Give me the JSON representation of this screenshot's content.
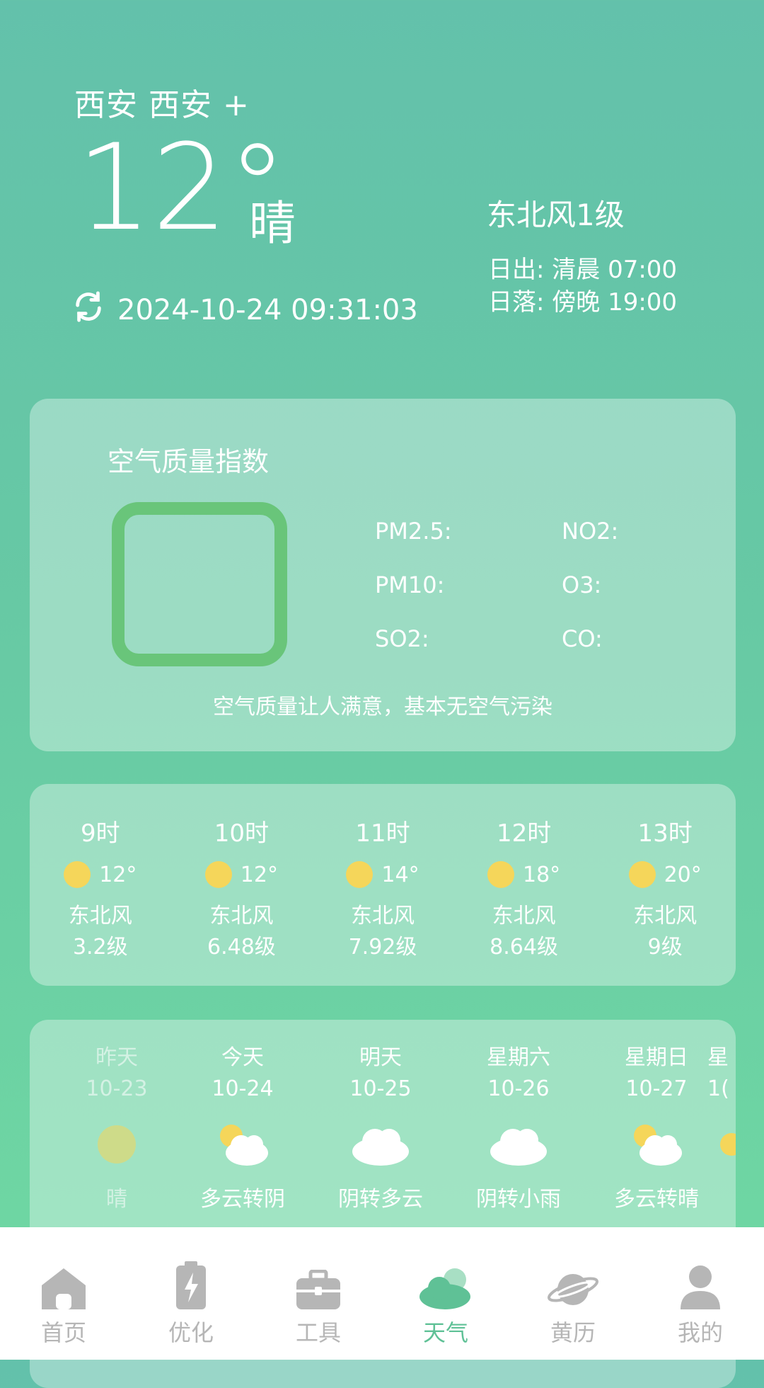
{
  "header": {
    "location": "西安 西安 +",
    "temperature": "12°",
    "condition": "晴",
    "wind": "东北风1级",
    "sunrise": "日出:  清晨  07:00",
    "sunset": "日落:  傍晚  19:00",
    "updated_at": "2024-10-24 09:31:03",
    "refresh_icon": "refresh-icon"
  },
  "aqi": {
    "title": "空气质量指数",
    "labels": [
      "PM2.5:",
      "NO2:",
      "PM10:",
      "O3:",
      "SO2:",
      "CO:"
    ],
    "description": "空气质量让人满意，基本无空气污染",
    "box_color": "#69c57a"
  },
  "hourly": [
    {
      "time": "9时",
      "temp": "12°",
      "wind": "东北风",
      "level": "3.2级"
    },
    {
      "time": "10时",
      "temp": "12°",
      "wind": "东北风",
      "level": "6.48级"
    },
    {
      "time": "11时",
      "temp": "14°",
      "wind": "东北风",
      "level": "7.92级"
    },
    {
      "time": "12时",
      "temp": "18°",
      "wind": "东北风",
      "level": "8.64级"
    },
    {
      "time": "13时",
      "temp": "20°",
      "wind": "东北风",
      "level": "9级"
    }
  ],
  "daily": [
    {
      "day": "昨天",
      "date": "10-23",
      "cond": "晴",
      "icon": "sun-icon"
    },
    {
      "day": "今天",
      "date": "10-24",
      "cond": "多云转阴",
      "icon": "partly-cloudy-icon"
    },
    {
      "day": "明天",
      "date": "10-25",
      "cond": "阴转多云",
      "icon": "cloud-icon"
    },
    {
      "day": "星期六",
      "date": "10-26",
      "cond": "阴转小雨",
      "icon": "cloud-icon"
    },
    {
      "day": "星期日",
      "date": "10-27",
      "cond": "多云转晴",
      "icon": "partly-cloudy-icon"
    },
    {
      "day": "星",
      "date": "1(",
      "cond": "",
      "icon": "sun-icon"
    }
  ],
  "nav": [
    {
      "label": "首页",
      "icon": "home-icon"
    },
    {
      "label": "优化",
      "icon": "battery-icon"
    },
    {
      "label": "工具",
      "icon": "toolbox-icon"
    },
    {
      "label": "天气",
      "icon": "weather-icon"
    },
    {
      "label": "黄历",
      "icon": "planet-icon"
    },
    {
      "label": "我的",
      "icon": "user-icon"
    }
  ],
  "colors": {
    "accent": "#5fc196",
    "nav_inactive": "#b6b6b6",
    "sun": "#f5d65a"
  }
}
